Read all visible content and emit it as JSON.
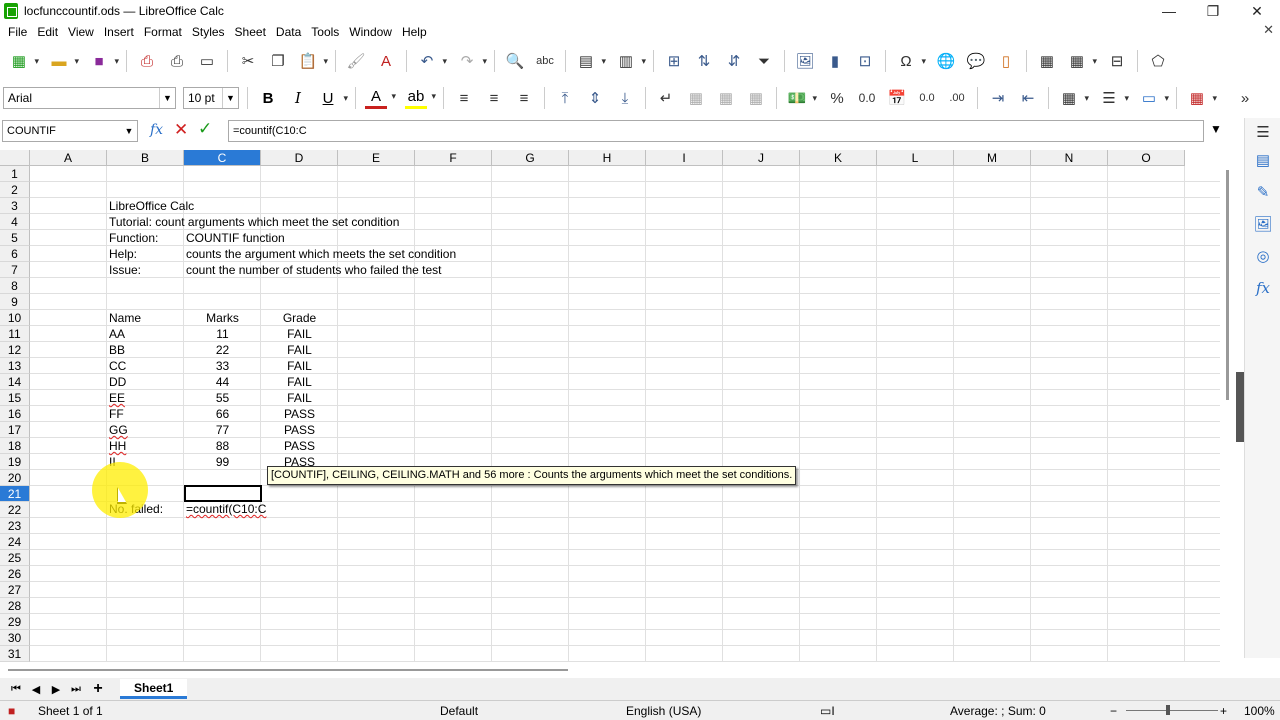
{
  "window": {
    "title": "locfunccountif.ods — LibreOffice Calc",
    "controls": {
      "minimize": "—",
      "maximize": "❐",
      "close": "✕"
    }
  },
  "menu": [
    "File",
    "Edit",
    "View",
    "Insert",
    "Format",
    "Styles",
    "Sheet",
    "Data",
    "Tools",
    "Window",
    "Help"
  ],
  "format_toolbar": {
    "font_name": "Arial",
    "font_size": "10 pt",
    "bold": "B",
    "italic": "I",
    "underline": "U",
    "percent": "%",
    "number": "0.0",
    "add_decimal": "0.0",
    "del_decimal": ".00"
  },
  "formula_bar": {
    "name_box": "COUNTIF",
    "fx": "fx",
    "cancel": "✕",
    "accept": "✓",
    "formula": "=countif(C10:C"
  },
  "columns": [
    "A",
    "B",
    "C",
    "D",
    "E",
    "F",
    "G",
    "H",
    "I",
    "J",
    "K",
    "L",
    "M",
    "N",
    "O"
  ],
  "active_column": "C",
  "active_row": 21,
  "rows": [
    1,
    2,
    3,
    4,
    5,
    6,
    7,
    8,
    9,
    10,
    11,
    12,
    13,
    14,
    15,
    16,
    17,
    18,
    19,
    20,
    21,
    22,
    23,
    24,
    25,
    26,
    27,
    28,
    29,
    30,
    31
  ],
  "info": {
    "b2": "LibreOffice Calc",
    "b3": "Tutorial: count arguments which meet the set condition",
    "b4": "Function:",
    "c4": "COUNTIF function",
    "b5": "Help:",
    "c5": "counts the argument which meets the set condition",
    "b6": "Issue:",
    "c6": "count the number of students who failed the test"
  },
  "table": {
    "headers": {
      "name": "Name",
      "marks": "Marks",
      "grade": "Grade"
    },
    "rows": [
      {
        "name": "AA",
        "marks": "11",
        "grade": "FAIL"
      },
      {
        "name": "BB",
        "marks": "22",
        "grade": "FAIL"
      },
      {
        "name": "CC",
        "marks": "33",
        "grade": "FAIL"
      },
      {
        "name": "DD",
        "marks": "44",
        "grade": "FAIL"
      },
      {
        "name": "EE",
        "marks": "55",
        "grade": "FAIL"
      },
      {
        "name": "FF",
        "marks": "66",
        "grade": "PASS"
      },
      {
        "name": "GG",
        "marks": "77",
        "grade": "PASS"
      },
      {
        "name": "HH",
        "marks": "88",
        "grade": "PASS"
      },
      {
        "name": "II",
        "marks": "99",
        "grade": "PASS"
      }
    ]
  },
  "b21": "No. failed:",
  "c21": "=countif(C10:C",
  "tooltip": "[COUNTIF], CEILING, CEILING.MATH and 56 more : Counts the arguments which meet the set conditions.",
  "sheet_tab": "Sheet1",
  "status": {
    "sheet": "Sheet 1 of 1",
    "page_style": "Default",
    "language": "English (USA)",
    "summary": "Average: ; Sum: 0",
    "zoom": "100%"
  }
}
